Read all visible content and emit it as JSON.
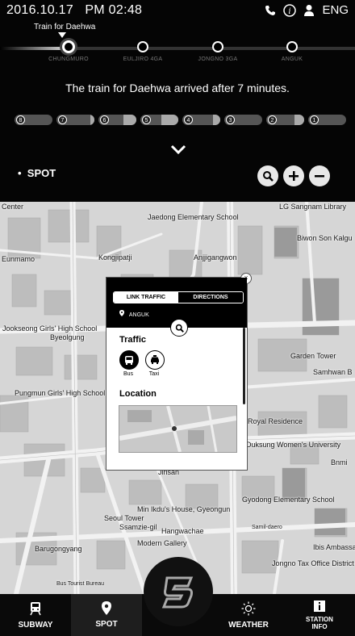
{
  "status": {
    "date": "2016.10.17",
    "time": "PM 02:48",
    "lang": "ENG"
  },
  "train": {
    "label": "Train for Daehwa",
    "stations": [
      "CHUNGMURO",
      "EULJIRO 4GA",
      "JONGNO 3GA",
      "ANGUK"
    ],
    "message": "The train for Daehwa arrived after 7 minutes."
  },
  "bars": [
    {
      "num": "8",
      "fill": 0.0
    },
    {
      "num": "7",
      "fill": 0.1
    },
    {
      "num": "6",
      "fill": 0.35
    },
    {
      "num": "5",
      "fill": 0.45
    },
    {
      "num": "4",
      "fill": 0.2
    },
    {
      "num": "3",
      "fill": 0.0
    },
    {
      "num": "2",
      "fill": 0.25
    },
    {
      "num": "1",
      "fill": 0.0
    }
  ],
  "spot_label": "SPOT",
  "map_labels": [
    "Center",
    "Jaedong Elementary School",
    "LG Sangnam Library",
    "Biwon Son Kalgu",
    "Eunmamo",
    "Kongjipatji",
    "Anjjigangwon",
    "Jookseong Girls' High School",
    "Byeolgung",
    "Pungmun Girls' High School",
    "Garden Tower",
    "Samhwan B",
    "Royal Residence",
    "Duksung Women's University",
    "Jirisan",
    "Min Ikdu's House, Gyeongun",
    "Gyodong Elementary School",
    "Seoul Tower",
    "Ssamzie-gil",
    "Hangwachae",
    "Modern Gallery",
    "Barugongyang",
    "Ibis Ambassador",
    "Jongno Tax Office District",
    "Bnmi",
    "Samil-daero",
    "Bus Tourist Bureau"
  ],
  "popup": {
    "tabs": [
      "LINK TRAFFIC",
      "DIRECTIONS"
    ],
    "station": "ANGUK",
    "traffic_title": "Traffic",
    "bus": "Bus",
    "taxi": "Taxi",
    "location_title": "Location"
  },
  "nav": {
    "subway": "SUBWAY",
    "spot": "SPOT",
    "weather": "WEATHER",
    "station_info": "STATION INFO"
  }
}
